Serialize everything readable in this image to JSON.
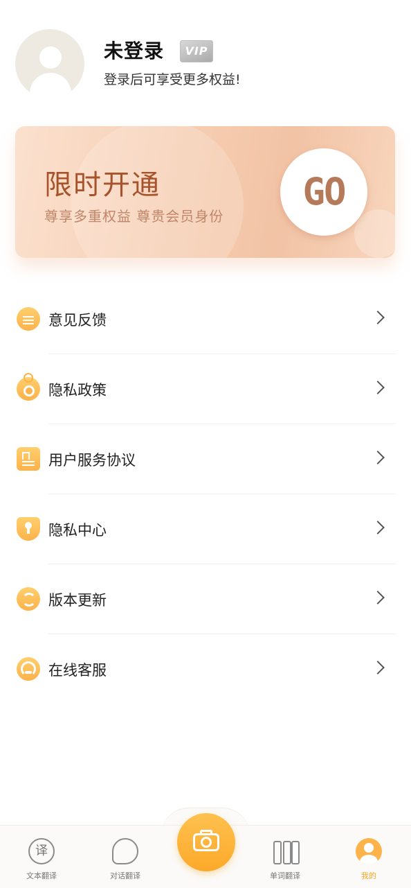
{
  "profile": {
    "name": "未登录",
    "vip_badge": "VIP",
    "subtitle": "登录后可享受更多权益!"
  },
  "banner": {
    "title": "限时开通",
    "subtitle": "尊享多重权益 尊贵会员身份",
    "go_label": "GO"
  },
  "menu": {
    "items": [
      {
        "label": "意见反馈",
        "icon": "feedback-icon"
      },
      {
        "label": "隐私政策",
        "icon": "privacy-policy-icon"
      },
      {
        "label": "用户服务协议",
        "icon": "agreement-icon"
      },
      {
        "label": "隐私中心",
        "icon": "shield-icon"
      },
      {
        "label": "版本更新",
        "icon": "update-icon"
      },
      {
        "label": "在线客服",
        "icon": "headset-icon"
      }
    ]
  },
  "tabbar": {
    "tabs": [
      {
        "label": "文本翻译",
        "glyph": "译"
      },
      {
        "label": "对话翻译"
      },
      {
        "label": "单词翻译"
      },
      {
        "label": "我的"
      }
    ],
    "active_tab": "我的"
  },
  "colors": {
    "accent": "#fdb24a",
    "banner_title": "#a6532c",
    "active_tab": "#f5a623"
  }
}
